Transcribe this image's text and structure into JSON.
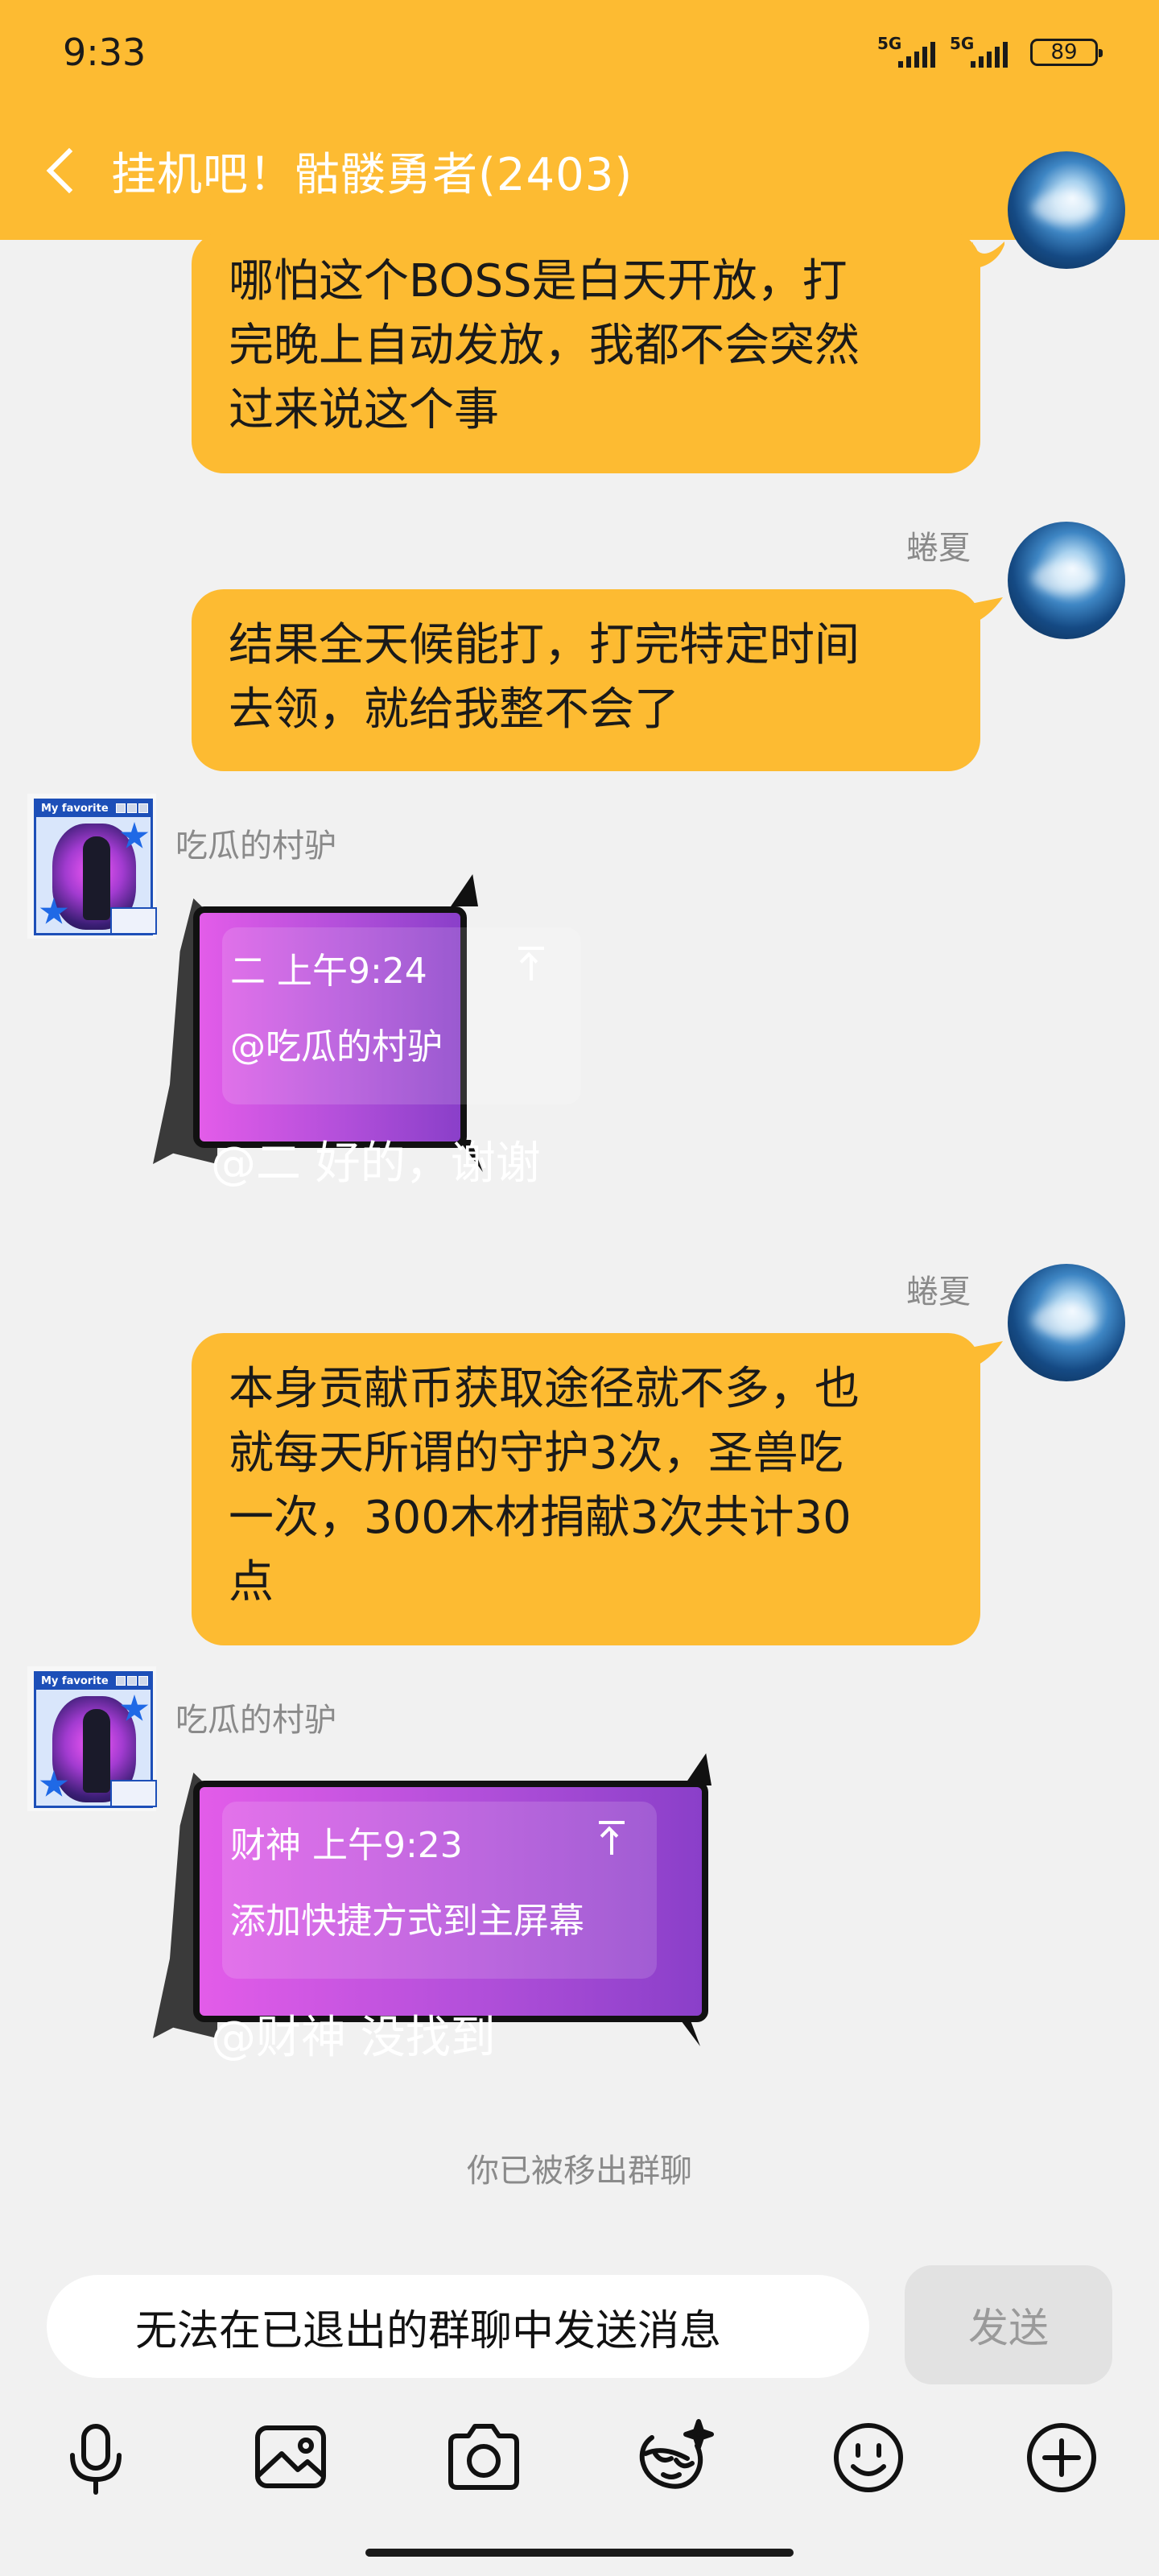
{
  "status_bar": {
    "time": "9:33",
    "signal1": "5G",
    "signal2": "5G",
    "battery": "89"
  },
  "header": {
    "title": "挂机吧！骷髅勇者(2403)"
  },
  "messages": [
    {
      "sender": "",
      "lines": [
        "哪怕这个BOSS是白天开放，打",
        "完晚上自动发放，我都不会突然",
        "过来说这个事"
      ]
    },
    {
      "sender": "蜷夏",
      "lines": [
        "结果全天候能打，打完特定时间",
        "去领，就给我整不会了"
      ]
    },
    {
      "sender": "吃瓜的村驴",
      "quote_head": "二 上午9:24",
      "quote_body": "@吃瓜的村驴",
      "reply": "@二 好的，谢谢"
    },
    {
      "sender": "蜷夏",
      "lines": [
        "本身贡献币获取途径就不多，也",
        "就每天所谓的守护3次，圣兽吃",
        "一次，300木材捐献3次共计30",
        "点"
      ]
    },
    {
      "sender": "吃瓜的村驴",
      "quote_head": "财神 上午9:23",
      "quote_body": "添加快捷方式到主屏幕",
      "reply": "@财神 没找到"
    }
  ],
  "avatar_text": "My favorite",
  "system_notice": "你已被移出群聊",
  "input": {
    "text": "无法在已退出的群聊中发送消息",
    "send_label": "发送"
  },
  "toolbar": [
    "microphone-icon",
    "image-icon",
    "camera-icon",
    "sticker-icon",
    "emoji-icon",
    "plus-icon"
  ],
  "colors": {
    "accent": "#fdbb32",
    "background": "#f1f1f1",
    "purple_bubble": "#b24fda"
  }
}
